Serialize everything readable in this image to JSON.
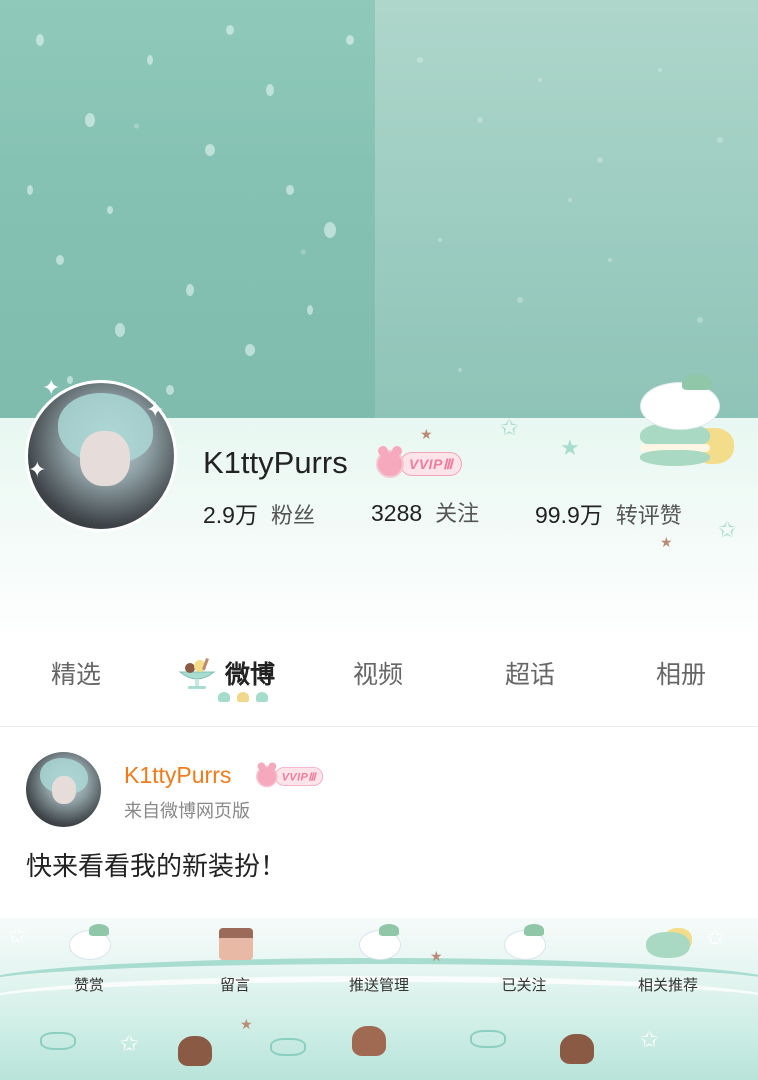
{
  "profile": {
    "username": "K1ttyPurrs",
    "vip_label": "VVIPⅢ",
    "stats": [
      {
        "value": "2.9万",
        "label": "粉丝"
      },
      {
        "value": "3288",
        "label": "关注"
      },
      {
        "value": "99.9万",
        "label": "转评赞"
      }
    ]
  },
  "tabs": [
    {
      "label": "精选",
      "active": false
    },
    {
      "label": "微博",
      "active": true
    },
    {
      "label": "视频",
      "active": false
    },
    {
      "label": "超话",
      "active": false
    },
    {
      "label": "相册",
      "active": false
    }
  ],
  "post": {
    "author": "K1ttyPurrs",
    "vip_label": "VVIPⅢ",
    "source": "来自微博网页版",
    "text": "快来看看我的新装扮！"
  },
  "actions": [
    {
      "label": "赞赏",
      "icon": "bunny-icon"
    },
    {
      "label": "留言",
      "icon": "cake-icon"
    },
    {
      "label": "推送管理",
      "icon": "bunny-icon"
    },
    {
      "label": "已关注",
      "icon": "bunny-icon"
    },
    {
      "label": "相关推荐",
      "icon": "macaron-icon"
    }
  ],
  "colors": {
    "accent_name": "#f07b1b",
    "mint": "#a7dccf",
    "vip_pink": "#f07d9c"
  }
}
